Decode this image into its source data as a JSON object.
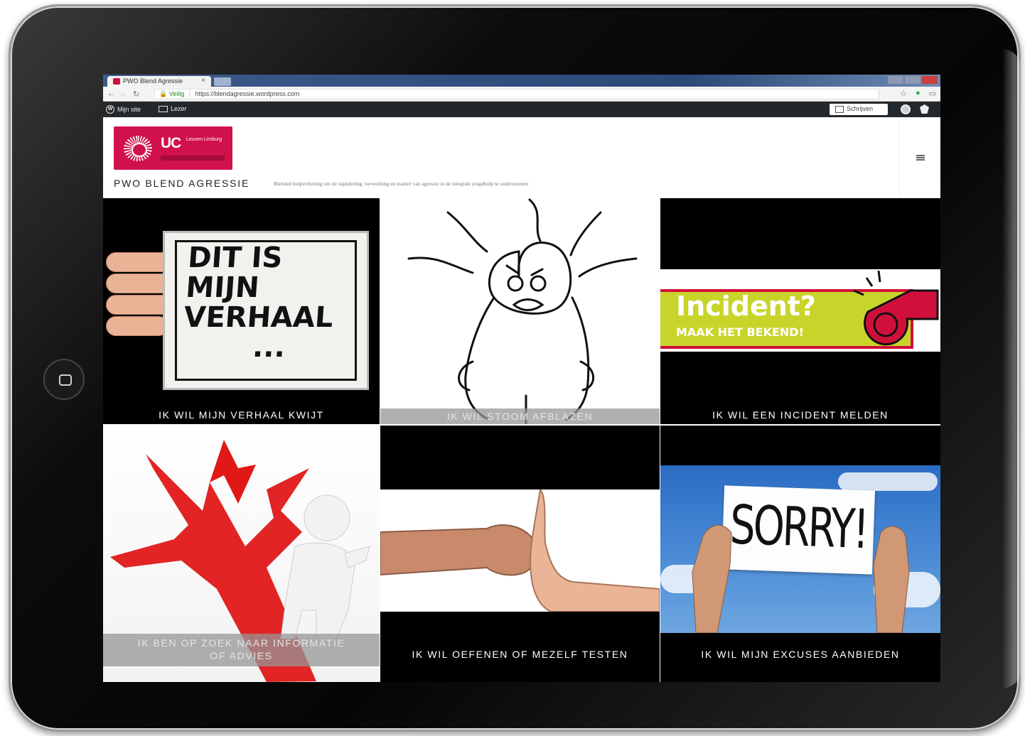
{
  "browser": {
    "tab_title": "PWO Blend Agressie",
    "tab_close": "×",
    "secure_label": "Veilig",
    "url": "https://blendagressie.wordpress.com"
  },
  "admin_bar": {
    "my_site": "Mijn site",
    "reader": "Lezer",
    "write_button": "Schrijven"
  },
  "site": {
    "logo_text": "UC",
    "logo_small": "Leuven Limburg",
    "title": "PWO BLEND AGRESSIE",
    "tagline": "Blended hulpverlening om de signalering, verwerking en manier van agressie in de integrale jeugdhulp te ondersteunen"
  },
  "tiles": [
    {
      "label": "IK WIL MIJN VERHAAL KWIJT",
      "image_text": [
        "DIT IS",
        "MIJN",
        "VERHAAL",
        "..."
      ]
    },
    {
      "label": "IK WIL STOOM AFBLAZEN"
    },
    {
      "label": "IK WIL EEN INCIDENT MELDEN",
      "image_text": [
        "Incident?",
        "MAAK HET BEKEND!"
      ]
    },
    {
      "label_line1": "IK BEN OP ZOEK NAAR INFORMATIE",
      "label_line2": "OF ADVIES"
    },
    {
      "label": "IK WIL OEFENEN OF MEZELF TESTEN"
    },
    {
      "label": "IK WIL MIJN EXCUSES AANBIEDEN",
      "image_text": [
        "SORRY!"
      ]
    }
  ],
  "colors": {
    "brand": "#d1114b",
    "admin_bar": "#23282d",
    "incident_green": "#c9d42a"
  }
}
